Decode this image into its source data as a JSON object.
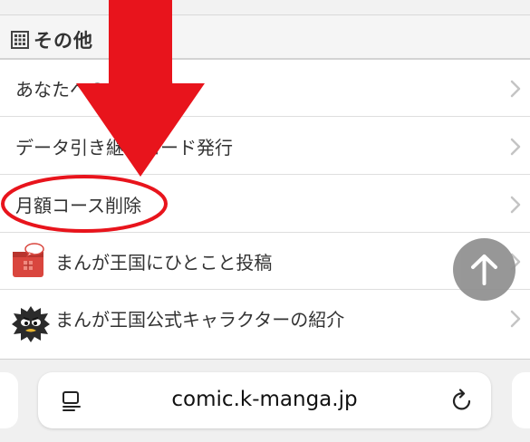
{
  "section": {
    "title": "その他",
    "icon": "grid-icon"
  },
  "menu": [
    {
      "label": "あなたへのおすすめ",
      "icon": null
    },
    {
      "label": "データ引き継ぎコード発行",
      "icon": null
    },
    {
      "label": "月額コース削除",
      "icon": null
    },
    {
      "label": "まんが王国にひとこと投稿",
      "icon": "mailbox-icon"
    },
    {
      "label": "まんが王国公式キャラクターの紹介",
      "icon": "mascot-icon"
    }
  ],
  "browser": {
    "url": "comic.k-manga.jp",
    "page_icon": "page-menu-icon",
    "reload_icon": "reload-icon"
  },
  "colors": {
    "annotation": "#e8141c",
    "scroll_button": "#8f8f8f"
  }
}
